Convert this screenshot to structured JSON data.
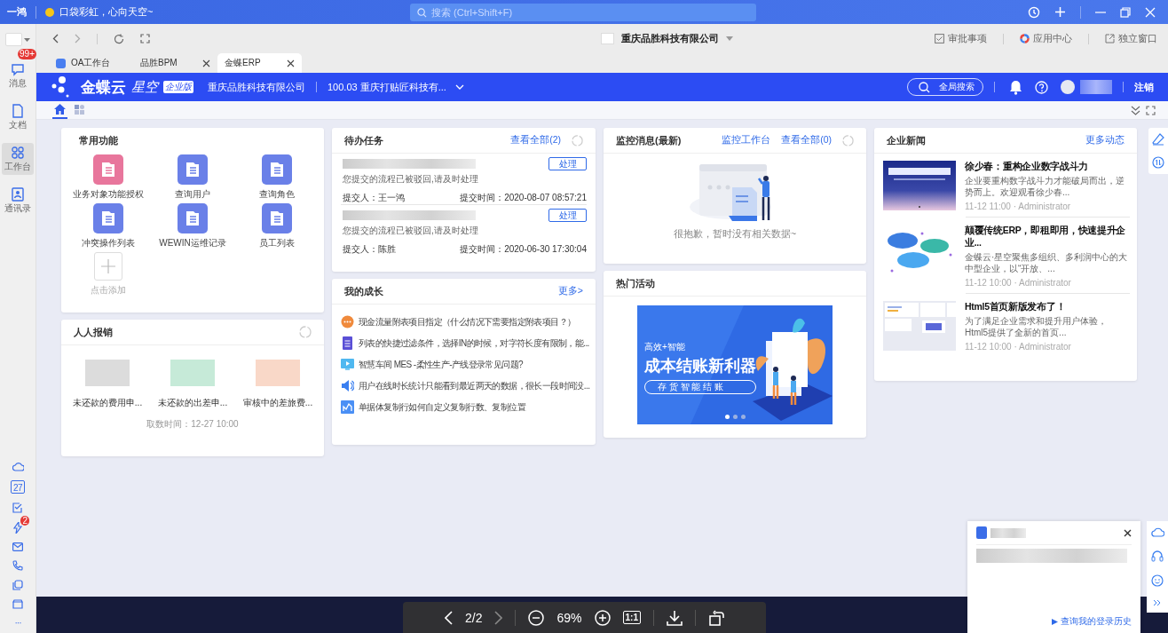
{
  "app_bar": {
    "logo": "一鸿",
    "status": "口袋彩虹，心向天空~",
    "search": {
      "placeholder": "搜索 (Ctrl+Shift+F)"
    }
  },
  "rail": {
    "items": [
      {
        "label": "消息",
        "badge": "99+",
        "selected": false
      },
      {
        "label": "文档",
        "selected": false
      },
      {
        "label": "工作台",
        "selected": true
      },
      {
        "label": "通讯录",
        "selected": false
      }
    ],
    "calendar_day": "27",
    "flash_badge": "2",
    "more": "···"
  },
  "toolbar": {
    "company": "重庆品胜科技有限公司",
    "links": [
      "审批事项",
      "应用中心",
      "独立窗口"
    ]
  },
  "tabs": [
    {
      "label": "OA工作台",
      "selected": false,
      "closable": false
    },
    {
      "label": "品胜BPM",
      "selected": false,
      "closable": true
    },
    {
      "label": "金蝶ERP",
      "selected": true,
      "closable": true
    }
  ],
  "erp_header": {
    "brand": "金蝶云",
    "brand_sub": "星空",
    "edition": "企业版",
    "company": "重庆品胜科技有限公司",
    "account": "100.03 重庆打贴匠科技有...",
    "search_label": "全局搜索",
    "logout": "注销"
  },
  "subnav": [
    {
      "kind": "home",
      "selected": true
    },
    {
      "kind": "apps",
      "selected": false
    }
  ],
  "common_functions": {
    "title": "常用功能",
    "items": [
      {
        "label": "业务对象功能授权",
        "color": "#e8769c"
      },
      {
        "label": "查询用户",
        "color": "#6a80e8"
      },
      {
        "label": "查询角色",
        "color": "#6a80e8"
      },
      {
        "label": "冲突操作列表",
        "color": "#6a80e8"
      },
      {
        "label": "WEWIN运维记录",
        "color": "#6a80e8"
      },
      {
        "label": "员工列表",
        "color": "#6a80e8"
      }
    ],
    "add_label": "点击添加"
  },
  "expense": {
    "title": "人人报销",
    "items": [
      {
        "label": "未还款的费用申...",
        "color": "#dcdcdc"
      },
      {
        "label": "未还款的出差申...",
        "color": "#c6ead8"
      },
      {
        "label": "审核中的差旅费...",
        "color": "#f9d8c8"
      }
    ],
    "fetched": "取数时间：12-27 10:00"
  },
  "todo": {
    "title": "待办任务",
    "view_all": "查看全部(2)",
    "tasks": [
      {
        "message": "您提交的流程已被驳回,请及时处理",
        "submitter": "提交人：王一鸿",
        "time": "提交时间：2020-08-07 08:57:21",
        "action": "处理"
      },
      {
        "message": "您提交的流程已被驳回,请及时处理",
        "submitter": "提交人：陈胜",
        "time": "提交时间：2020-06-30 17:30:04",
        "action": "处理"
      }
    ]
  },
  "growth": {
    "title": "我的成长",
    "more": "更多>",
    "items": [
      {
        "kind": "chat",
        "text": "现金流量附表项目指定（什么情况下需要指定附表项目？）"
      },
      {
        "kind": "doc",
        "text": "列表的快捷过滤条件，选择IN的时候，对字符长度有限制，能..."
      },
      {
        "kind": "video",
        "text": "智慧车间 MES -柔性生产-产线登录常见问题?"
      },
      {
        "kind": "speaker",
        "text": "用户在线时长统计只能看到最近两天的数据，很长一段时间没..."
      },
      {
        "kind": "chart",
        "text": "单据体复制行如何自定义复制行数、复制位置"
      }
    ]
  },
  "monitor": {
    "title": "监控消息(最新)",
    "links": [
      "监控工作台",
      "查看全部(0)"
    ],
    "empty": "很抱歉，暂时没有相关数据~"
  },
  "activity": {
    "title": "热门活动",
    "banner": {
      "tag": "高效+智能",
      "headline": "成本结账新利器",
      "button": "存 货 智 能 结 账"
    },
    "slides": [
      {
        "selected": true
      },
      {
        "selected": false
      },
      {
        "selected": false
      }
    ]
  },
  "news": {
    "title": "企业新闻",
    "more": "更多动态",
    "items": [
      {
        "kind": "title_card",
        "title": "徐少春：重构企业数字战斗力",
        "summary": "企业要重构数字战斗力才能破局而出，逆势而上。欢迎观看徐少春...",
        "meta": "11-12 11:00 · Administrator"
      },
      {
        "kind": "clouds",
        "title": "颠覆传统ERP，即租即用，快速提升企业...",
        "summary": "金蝶云·星空聚焦多组织、多利润中心的大中型企业，以“开放、...",
        "meta": "11-12 10:00 · Administrator"
      },
      {
        "kind": "screens",
        "title": "Html5首页新版发布了！",
        "summary": "为了满足企业需求和提升用户体验，Html5提供了全新的首页...",
        "meta": "11-12 10:00 · Administrator"
      }
    ]
  },
  "viewer": {
    "page": "2/2",
    "zoom": "69%",
    "actual_size": "1:1"
  },
  "chat": {
    "link": "查询我的登录历史"
  }
}
